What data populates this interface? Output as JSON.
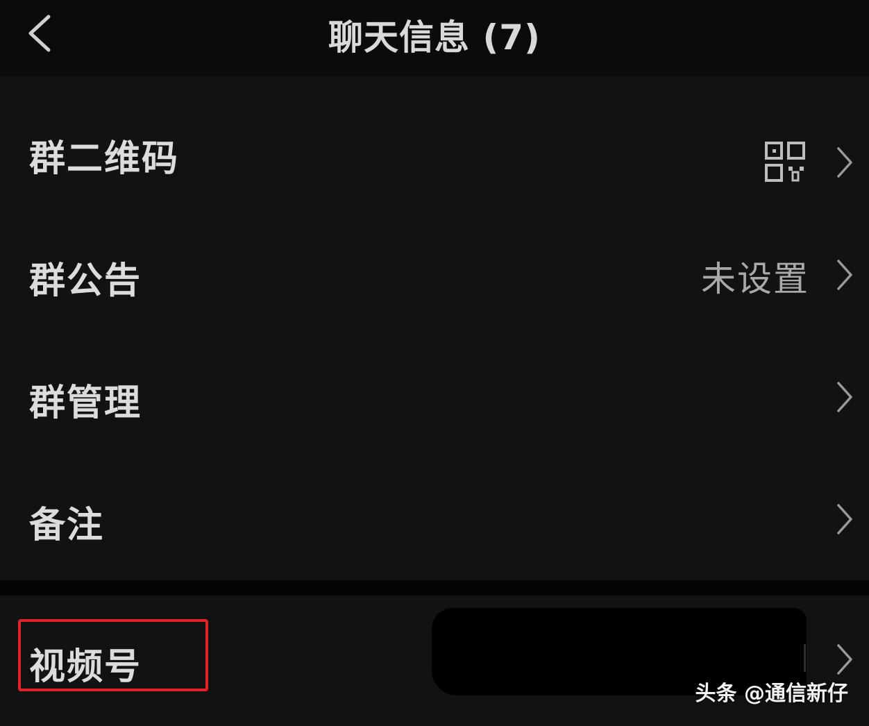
{
  "header": {
    "title": "聊天信息 (7)",
    "back_icon": "chevron-left-icon"
  },
  "settings": {
    "qr_code": {
      "label": "群二维码",
      "icon": "qr-code-icon"
    },
    "announcement": {
      "label": "群公告",
      "value": "未设置"
    },
    "management": {
      "label": "群管理"
    },
    "remark": {
      "label": "备注"
    }
  },
  "channels": {
    "label": "视频号"
  },
  "watermark": {
    "text": "头条 @通信新仔"
  },
  "colors": {
    "background": "#000000",
    "row_background": "#121212",
    "text": "#dcdcdc",
    "secondary_text": "#a9a9a9",
    "highlight": "#e0232b"
  }
}
